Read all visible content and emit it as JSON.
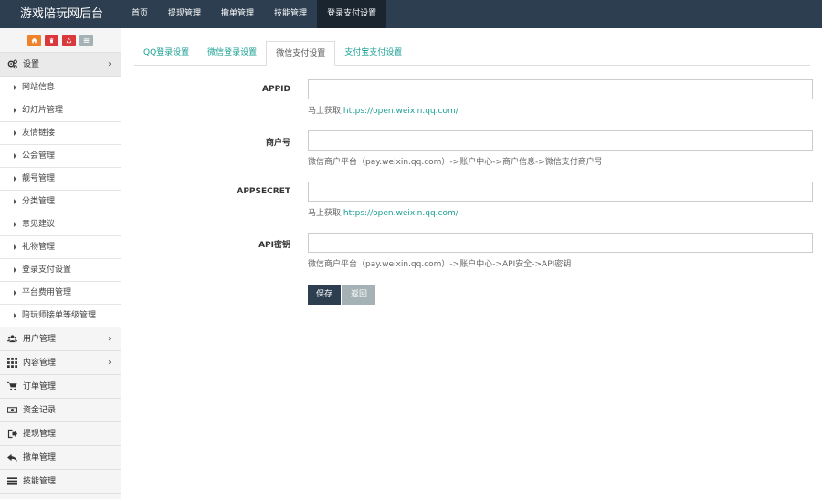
{
  "app": {
    "title": "游戏陪玩网后台"
  },
  "topnav": [
    {
      "label": "首页",
      "active": false
    },
    {
      "label": "提现管理",
      "active": false
    },
    {
      "label": "撤单管理",
      "active": false
    },
    {
      "label": "技能管理",
      "active": false
    },
    {
      "label": "登录支付设置",
      "active": true
    }
  ],
  "quick_buttons": [
    {
      "icon": "home-icon",
      "color": "#f0822c"
    },
    {
      "icon": "trash-icon",
      "color": "#d9393b"
    },
    {
      "icon": "recycle-icon",
      "color": "#d9393b"
    },
    {
      "icon": "list-icon",
      "color": "#a4b1b5"
    }
  ],
  "sidebar": {
    "settings": {
      "label": "设置",
      "icon": "gears-icon"
    },
    "settings_items": [
      "网站信息",
      "幻灯片管理",
      "友情链接",
      "公会管理",
      "靓号管理",
      "分类管理",
      "意见建议",
      "礼物管理",
      "登录支付设置",
      "平台费用管理",
      "陪玩师接单等级管理"
    ],
    "groups": [
      {
        "label": "用户管理",
        "icon": "users-icon",
        "chevron": true
      },
      {
        "label": "内容管理",
        "icon": "grid-icon",
        "chevron": true
      },
      {
        "label": "订单管理",
        "icon": "cart-icon",
        "chevron": false
      },
      {
        "label": "资金记录",
        "icon": "money-icon",
        "chevron": false
      },
      {
        "label": "提现管理",
        "icon": "sign-out-icon",
        "chevron": false
      },
      {
        "label": "撤单管理",
        "icon": "reply-icon",
        "chevron": false
      },
      {
        "label": "技能管理",
        "icon": "bars-icon",
        "chevron": false
      }
    ]
  },
  "tabs": [
    {
      "label": "QQ登录设置",
      "active": false
    },
    {
      "label": "微信登录设置",
      "active": false
    },
    {
      "label": "微信支付设置",
      "active": true
    },
    {
      "label": "支付宝支付设置",
      "active": false
    }
  ],
  "form": {
    "appid": {
      "label": "APPID",
      "value": "",
      "help_prefix": "马上获取,",
      "help_link": "https://open.weixin.qq.com/"
    },
    "mchid": {
      "label": "商户号",
      "value": "",
      "help": "微信商户平台（pay.weixin.qq.com）->账户中心->商户信息->微信支付商户号"
    },
    "appsecret": {
      "label": "APPSECRET",
      "value": "",
      "help_prefix": "马上获取,",
      "help_link": "https://open.weixin.qq.com/"
    },
    "apikey": {
      "label": "API密钥",
      "value": "",
      "help": "微信商户平台（pay.weixin.qq.com）->账户中心->API安全->API密钥"
    }
  },
  "buttons": {
    "save": "保存",
    "back": "返回"
  },
  "colors": {
    "topbar": "#2c3e50",
    "accent": "#1aa094",
    "save": "#2c3e50",
    "back": "#a4b1b5"
  }
}
